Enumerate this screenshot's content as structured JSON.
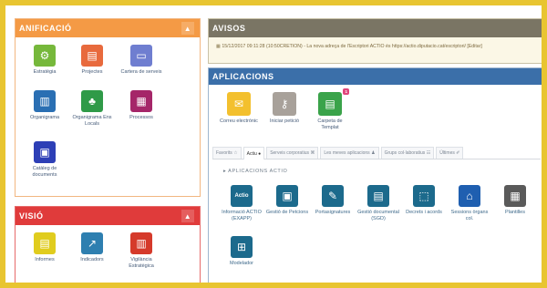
{
  "planificacio": {
    "title": "ANIFICACIÓ",
    "items": [
      {
        "label": "Estratègia",
        "icon": "strategy-icon",
        "color": "#76b83b"
      },
      {
        "label": "Projectes",
        "icon": "folders-icon",
        "color": "#e86a3d"
      },
      {
        "label": "Cartera de serveis",
        "icon": "services-icon",
        "color": "#6f7ed0"
      },
      {
        "label": "Organigrama",
        "icon": "org-chart-icon",
        "color": "#2a6fb3"
      },
      {
        "label": "Organigrama Ens Locals",
        "icon": "local-org-icon",
        "color": "#2f9a48"
      },
      {
        "label": "Processos",
        "icon": "processes-icon",
        "color": "#a52669"
      },
      {
        "label": "Catàleg de documents",
        "icon": "catalog-icon",
        "color": "#2d3fb6"
      }
    ]
  },
  "visio": {
    "title": "VISIÓ",
    "items": [
      {
        "label": "Informes",
        "icon": "reports-icon",
        "color": "#e0cc1e"
      },
      {
        "label": "Indicadors",
        "icon": "indicators-icon",
        "color": "#2e7fb0"
      },
      {
        "label": "Vigilància Estratègica",
        "icon": "surveillance-icon",
        "color": "#d53a2b"
      }
    ]
  },
  "avisos": {
    "title": "AVISOS",
    "notice": "15/12/2017 09:11:28 (10:50CRETION) - La nova adreça de l'Escriptori ACTIO és https://actio.diputacio.cat/escriptori/ [Editar]"
  },
  "aplicacions": {
    "title": "APLICACIONS",
    "quick": [
      {
        "label": "Correu electrònic",
        "icon": "mail-icon",
        "color": "#f3c02e"
      },
      {
        "label": "Iniciar petició",
        "icon": "key-icon",
        "color": "#a8a19a"
      },
      {
        "label": "Carpeta de Templat",
        "icon": "template-icon",
        "color": "#3aa34a",
        "badge": "1"
      }
    ],
    "tabs": [
      "Favorits ☆",
      "Actiu ●",
      "Serveis corporatius ⌘",
      "Les meves aplicacions ♟",
      "Grups col·laboratius ☷",
      "Últimes ✐"
    ],
    "section": "▸ APLICACIONS ACTIO",
    "apps": [
      {
        "label": "Informació ACTIO (EXAPP)",
        "icon": "actio-icon",
        "text": "Actio"
      },
      {
        "label": "Gestió de Petcions",
        "icon": "petitions-icon",
        "text": "▣"
      },
      {
        "label": "Portasignatures",
        "icon": "signature-icon",
        "text": "✎"
      },
      {
        "label": "Gestió documental (SGD)",
        "icon": "documents-icon",
        "text": "▤"
      },
      {
        "label": "Decrets i acords",
        "icon": "decrees-icon",
        "text": "⬚"
      },
      {
        "label": "Sessions òrgans col.",
        "icon": "sessions-icon",
        "text": "⌂",
        "color": "#1f5fb0"
      },
      {
        "label": "Plantilles",
        "icon": "templates-icon",
        "text": "▦",
        "color": "#5a5a5a"
      },
      {
        "label": "Modelador",
        "icon": "modeler-icon",
        "text": "⊞"
      }
    ]
  }
}
